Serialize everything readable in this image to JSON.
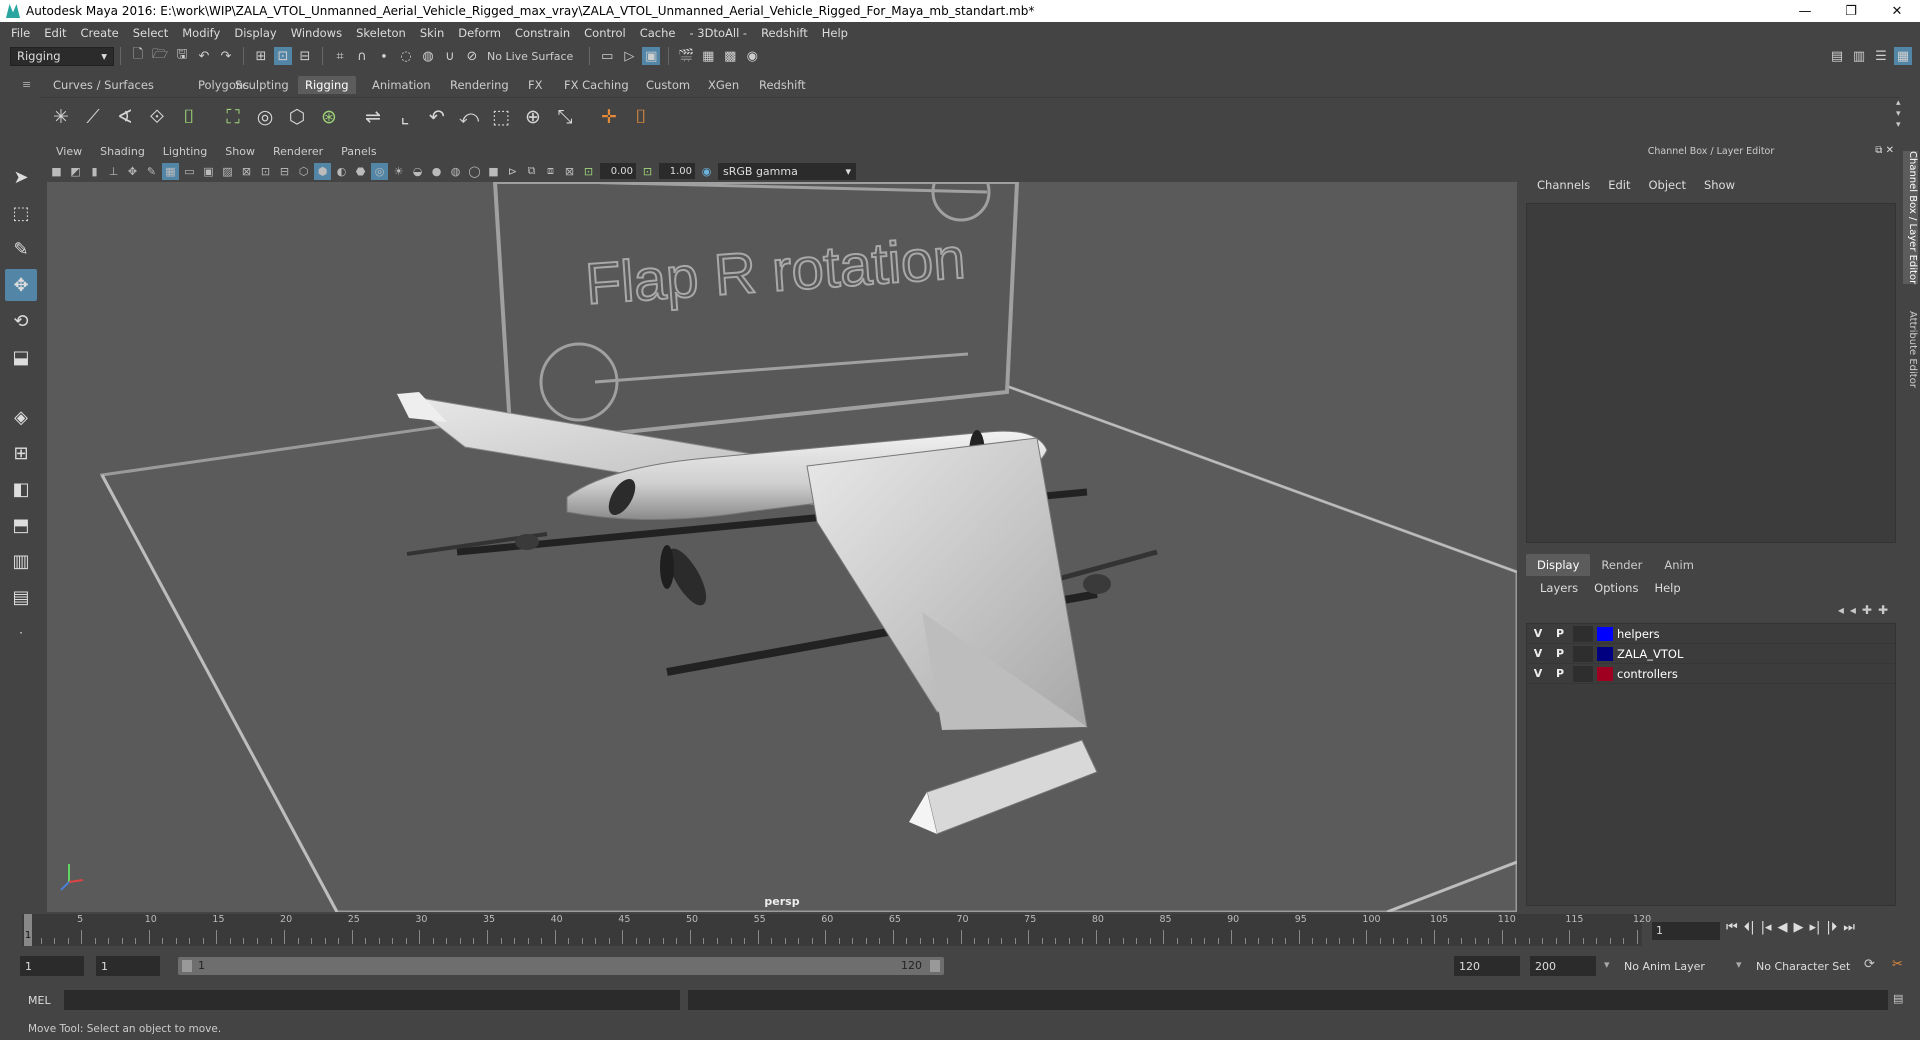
{
  "window": {
    "title": "Autodesk Maya 2016: E:\\work\\WIP\\ZALA_VTOL_Unmanned_Aerial_Vehicle_Rigged_max_vray\\ZALA_VTOL_Unmanned_Aerial_Vehicle_Rigged_For_Maya_mb_standart.mb*",
    "minimize": "—",
    "maximize": "❐",
    "close": "✕"
  },
  "menubar": [
    "File",
    "Edit",
    "Create",
    "Select",
    "Modify",
    "Display",
    "Windows",
    "Skeleton",
    "Skin",
    "Deform",
    "Constrain",
    "Control",
    "Cache",
    "- 3DtoAll -",
    "Redshift",
    "Help"
  ],
  "statusline": {
    "menuset": "Rigging",
    "live_surface": "No Live Surface"
  },
  "shelf_tabs": [
    "Curves / Surfaces",
    "Polygons",
    "Sculpting",
    "Rigging",
    "Animation",
    "Rendering",
    "FX",
    "FX Caching",
    "Custom",
    "XGen",
    "Redshift"
  ],
  "shelf_active": "Rigging",
  "viewport": {
    "menu": [
      "View",
      "Shading",
      "Lighting",
      "Show",
      "Renderer",
      "Panels"
    ],
    "exposure": "0.00",
    "gamma": "1.00",
    "color_space": "sRGB gamma",
    "camera_label": "persp",
    "annotation_text": "Flap R rotation"
  },
  "channel_box": {
    "header": "Channel Box / Layer Editor",
    "menu": [
      "Channels",
      "Edit",
      "Object",
      "Show"
    ]
  },
  "layer_editor": {
    "tabs": [
      "Display",
      "Render",
      "Anim"
    ],
    "active_tab": "Display",
    "menu": [
      "Layers",
      "Options",
      "Help"
    ],
    "layers": [
      {
        "v": "V",
        "p": "P",
        "name": "helpers",
        "color": "#0000ff"
      },
      {
        "v": "V",
        "p": "P",
        "name": "ZALA_VTOL",
        "color": "#000080"
      },
      {
        "v": "V",
        "p": "P",
        "name": "controllers",
        "color": "#a00020"
      }
    ]
  },
  "side_tabs": [
    "Channel Box / Layer Editor",
    "Attribute Editor"
  ],
  "timeline": {
    "labels": [
      "5",
      "10",
      "15",
      "20",
      "25",
      "30",
      "35",
      "40",
      "45",
      "50",
      "55",
      "60",
      "65",
      "70",
      "75",
      "80",
      "85",
      "90",
      "95",
      "100",
      "105",
      "110",
      "115",
      "120"
    ],
    "current_marker": "1",
    "current_frame": "1"
  },
  "range": {
    "start": "1",
    "anim_start": "1",
    "slider_start": "1",
    "slider_end": "120",
    "anim_end": "120",
    "end": "200",
    "anim_layer": "No Anim Layer",
    "character_set": "No Character Set"
  },
  "command_line": {
    "label": "MEL"
  },
  "help_line": "Move Tool: Select an object to move."
}
